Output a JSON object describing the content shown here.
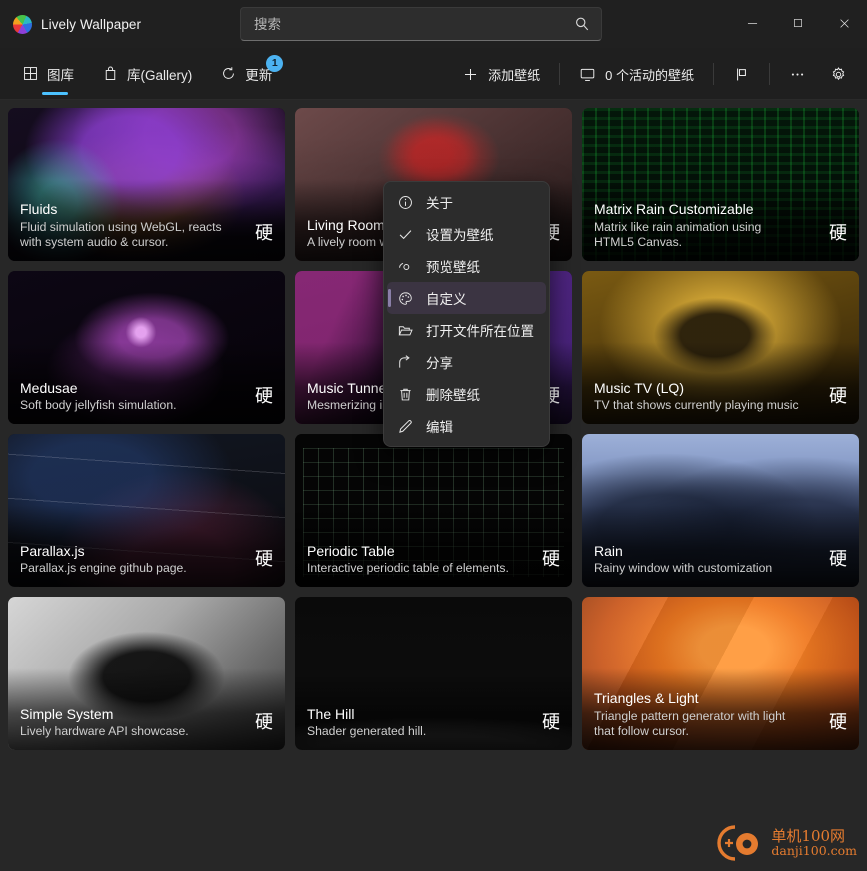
{
  "window": {
    "app_title": "Lively Wallpaper",
    "logo_icon": "lively-logo-icon",
    "controls": {
      "minimize": "minimize-icon",
      "maximize": "maximize-icon",
      "close": "close-icon"
    }
  },
  "search": {
    "placeholder": "搜索",
    "value": "",
    "icon": "search-icon"
  },
  "toolbar": {
    "tabs": [
      {
        "label": "图库",
        "icon": "grid-icon",
        "active": true,
        "badge": null
      },
      {
        "label": "库(Gallery)",
        "icon": "bag-icon",
        "active": false,
        "badge": null
      },
      {
        "label": "更新",
        "icon": "refresh-icon",
        "active": false,
        "badge": "1"
      }
    ],
    "actions": [
      {
        "label": "添加壁纸",
        "icon": "plus-icon"
      },
      {
        "label": "0 个活动的壁纸",
        "icon": "monitor-icon"
      }
    ],
    "layout_icon": "layout-split-icon",
    "more_icon": "more-ellipsis-icon",
    "settings_icon": "gear-icon"
  },
  "context_menu": {
    "items": [
      {
        "label": "关于",
        "icon": "info-circle-icon",
        "selected": false
      },
      {
        "label": "设置为壁纸",
        "icon": "check-icon",
        "selected": false
      },
      {
        "label": "预览壁纸",
        "icon": "preview-eye-icon",
        "selected": false
      },
      {
        "label": "自定义",
        "icon": "palette-icon",
        "selected": true
      },
      {
        "label": "打开文件所在位置",
        "icon": "folder-open-icon",
        "selected": false
      },
      {
        "label": "分享",
        "icon": "share-icon",
        "selected": false
      },
      {
        "label": "删除壁纸",
        "icon": "trash-icon",
        "selected": false
      },
      {
        "label": "编辑",
        "icon": "pencil-icon",
        "selected": false
      }
    ]
  },
  "gallery": {
    "hw_badge": "硬",
    "cards": [
      {
        "title": "Fluids",
        "desc": "Fluid simulation using WebGL, reacts with system audio & cursor.",
        "art": "fluids",
        "badge": true
      },
      {
        "title": "Living Room",
        "desc": "A lively room with TV and more!",
        "art": "living-room",
        "badge": true
      },
      {
        "title": "Matrix Rain Customizable",
        "desc": "Matrix like rain animation using HTML5 Canvas.",
        "art": "matrix",
        "badge": true
      },
      {
        "title": "Medusae",
        "desc": "Soft body jellyfish simulation.",
        "art": "medusae",
        "badge": true
      },
      {
        "title": "Music Tunnel",
        "desc": "Mesmerizing infinite tunnel",
        "art": "music-tunnel",
        "badge": true
      },
      {
        "title": "Music TV (LQ)",
        "desc": "TV that shows currently playing music",
        "art": "music-tv",
        "badge": true
      },
      {
        "title": "Parallax.js",
        "desc": "Parallax.js engine github page.",
        "art": "parallax",
        "badge": true
      },
      {
        "title": "Periodic Table",
        "desc": "Interactive periodic table of elements.",
        "art": "periodic",
        "badge": true
      },
      {
        "title": "Rain",
        "desc": "Rainy window with customization",
        "art": "rain",
        "badge": true
      },
      {
        "title": "Simple System",
        "desc": "Lively hardware API showcase.",
        "art": "simple-system",
        "badge": true
      },
      {
        "title": "The Hill",
        "desc": "Shader generated hill.",
        "art": "the-hill",
        "badge": true
      },
      {
        "title": "Triangles & Light",
        "desc": "Triangle pattern generator with light that follow cursor.",
        "art": "triangles",
        "badge": true
      }
    ]
  },
  "watermark": {
    "cn": "单机100网",
    "en": "danji100.com",
    "color": "#ef8030"
  },
  "colors": {
    "accent": "#4cc2ff",
    "badge": "#4cb2f0",
    "titlebar_bg": "#202020",
    "toolbar_bg": "#1f1f1f",
    "content_bg": "#272727",
    "menu_bg": "#2c2c2c"
  }
}
